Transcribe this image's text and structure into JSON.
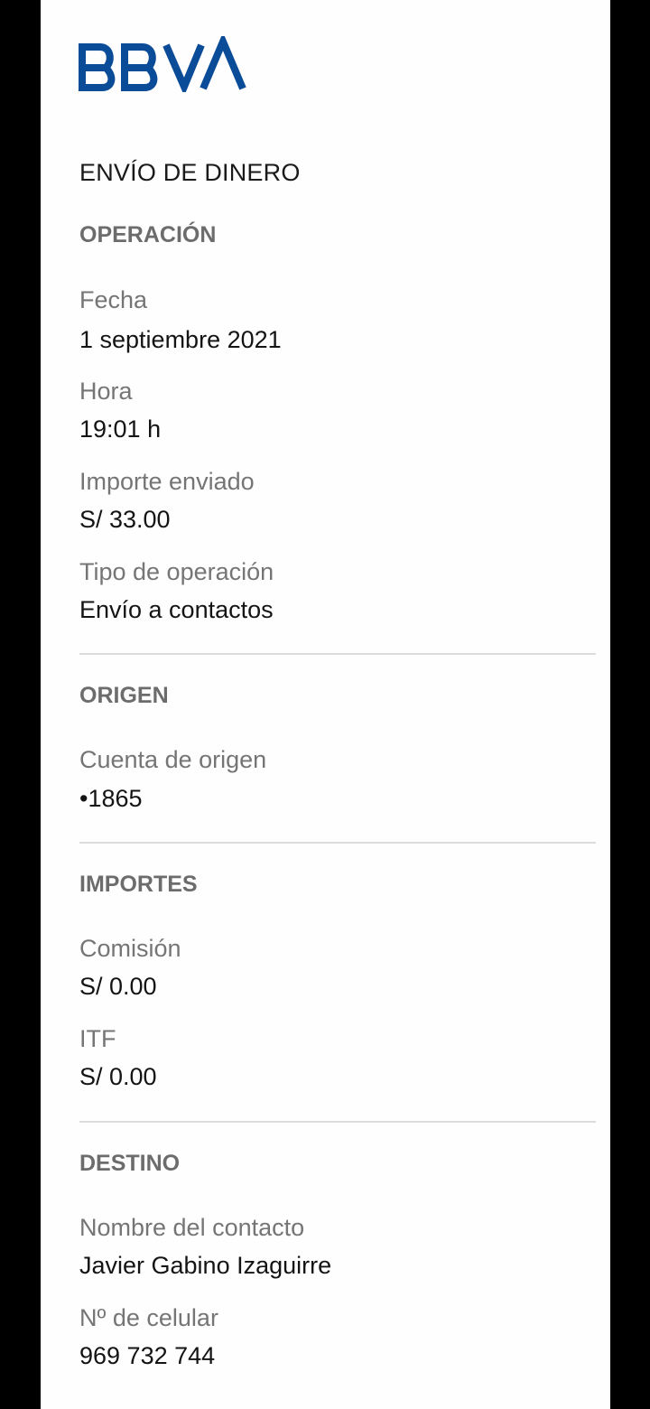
{
  "brand": {
    "logo_text": "BBVA",
    "color": "#0b4c99"
  },
  "receipt": {
    "title": "ENVÍO DE DINERO",
    "operacion": {
      "heading": "OPERACIÓN",
      "fecha_label": "Fecha",
      "fecha_value": "1 septiembre 2021",
      "hora_label": "Hora",
      "hora_value": "19:01 h",
      "importe_label": "Importe enviado",
      "importe_value": "S/ 33.00",
      "tipo_label": "Tipo de operación",
      "tipo_value": "Envío a contactos"
    },
    "origen": {
      "heading": "ORIGEN",
      "cuenta_label": "Cuenta de origen",
      "cuenta_value": "•1865"
    },
    "importes": {
      "heading": "IMPORTES",
      "comision_label": "Comisión",
      "comision_value": "S/ 0.00",
      "itf_label": "ITF",
      "itf_value": "S/ 0.00"
    },
    "destino": {
      "heading": "DESTINO",
      "nombre_label": "Nombre del contacto",
      "nombre_value": "Javier Gabino Izaguirre",
      "celular_label": "Nº de celular",
      "celular_value": "969 732 744"
    }
  }
}
